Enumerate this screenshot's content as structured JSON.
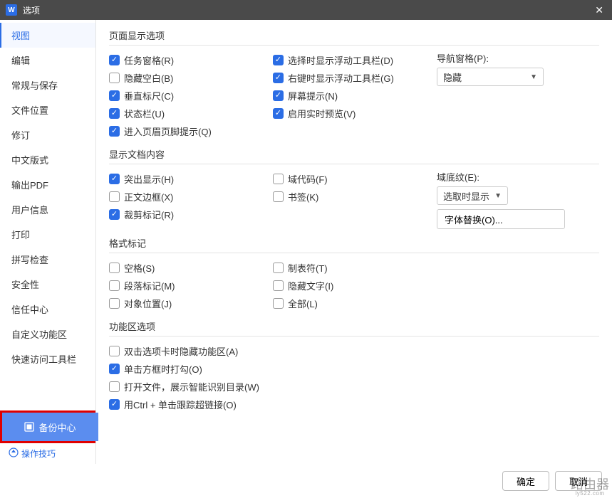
{
  "titlebar": {
    "app_badge": "W",
    "title": "选项"
  },
  "sidebar": {
    "items": [
      "视图",
      "编辑",
      "常规与保存",
      "文件位置",
      "修订",
      "中文版式",
      "输出PDF",
      "用户信息",
      "打印",
      "拼写检查",
      "安全性",
      "信任中心",
      "自定义功能区",
      "快速访问工具栏"
    ],
    "backup": "备份中心",
    "tips": "操作技巧"
  },
  "sections": {
    "s1": {
      "title": "页面显示选项",
      "col1": [
        "任务窗格(R)",
        "隐藏空白(B)",
        "垂直标尺(C)",
        "状态栏(U)",
        "进入页眉页脚提示(Q)"
      ],
      "col1_checked": [
        true,
        false,
        true,
        true,
        true
      ],
      "col2": [
        "选择时显示浮动工具栏(D)",
        "右键时显示浮动工具栏(G)",
        "屏幕提示(N)",
        "启用实时预览(V)"
      ],
      "col2_checked": [
        true,
        true,
        true,
        true
      ],
      "nav_label": "导航窗格(P):",
      "nav_value": "隐藏"
    },
    "s2": {
      "title": "显示文档内容",
      "col1": [
        "突出显示(H)",
        "正文边框(X)",
        "裁剪标记(R)"
      ],
      "col1_checked": [
        true,
        false,
        true
      ],
      "col2": [
        "域代码(F)",
        "书签(K)"
      ],
      "col2_checked": [
        false,
        false
      ],
      "shade_label": "域底纹(E):",
      "shade_value": "选取时显示",
      "font_sub": "字体替换(O)..."
    },
    "s3": {
      "title": "格式标记",
      "col1": [
        "空格(S)",
        "段落标记(M)",
        "对象位置(J)"
      ],
      "col2": [
        "制表符(T)",
        "隐藏文字(I)",
        "全部(L)"
      ]
    },
    "s4": {
      "title": "功能区选项",
      "items": [
        "双击选项卡时隐藏功能区(A)",
        "单击方框时打勾(O)",
        "打开文件，展示智能识别目录(W)",
        "用Ctrl + 单击跟踪超链接(O)"
      ],
      "checked": [
        false,
        true,
        false,
        true
      ]
    }
  },
  "footer": {
    "ok": "确定",
    "cancel": "取消"
  },
  "watermark": {
    "main": "路由器",
    "sub": "ly522.com"
  }
}
